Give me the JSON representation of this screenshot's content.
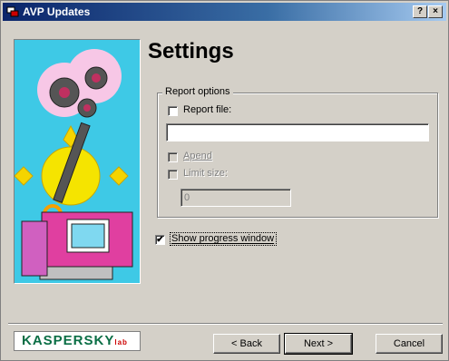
{
  "window": {
    "title": "AVP Updates",
    "help_label": "?",
    "close_label": "×"
  },
  "page": {
    "heading": "Settings"
  },
  "report_options": {
    "legend": "Report options",
    "report_file": {
      "label": "Report file:",
      "checked": false,
      "value": ""
    },
    "append": {
      "label": "Apend",
      "checked": false,
      "enabled": false
    },
    "limit_size": {
      "label": "Limit size:",
      "checked": false,
      "enabled": false,
      "value": "0"
    }
  },
  "show_progress": {
    "label": "Show progress window",
    "checked": true,
    "check_mark": "✔"
  },
  "logo": {
    "text": "KASPERSKY",
    "lab": "lab"
  },
  "buttons": {
    "back": "< Back",
    "next": "Next >",
    "cancel": "Cancel"
  }
}
